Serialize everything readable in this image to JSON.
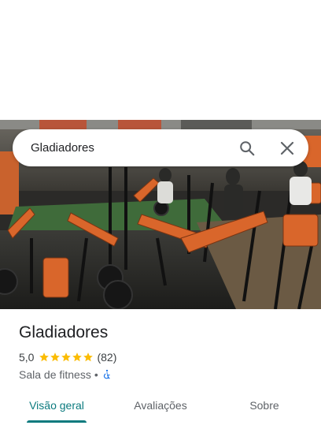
{
  "search": {
    "value": "Gladiadores"
  },
  "place": {
    "title": "Gladiadores",
    "rating": "5,0",
    "stars": 5,
    "review_count": "(82)",
    "category": "Sala de fitness",
    "separator": "•",
    "accessibility_icon": "wheelchair-icon"
  },
  "tabs": [
    {
      "label": "Visão geral",
      "active": true
    },
    {
      "label": "Avaliações",
      "active": false
    },
    {
      "label": "Sobre",
      "active": false
    }
  ],
  "colors": {
    "accent": "#0b7a7e",
    "star": "#fbbc04",
    "accessibility": "#1a73e8",
    "equipment_orange": "#d9662b"
  }
}
